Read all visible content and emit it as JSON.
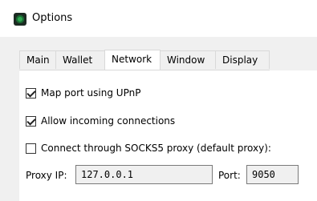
{
  "window": {
    "title": "Options"
  },
  "tabs": [
    {
      "label": "Main"
    },
    {
      "label": "Wallet"
    },
    {
      "label": "Network",
      "active": true
    },
    {
      "label": "Window"
    },
    {
      "label": "Display"
    }
  ],
  "network": {
    "upnp": {
      "label": "Map port using UPnP",
      "checked": true
    },
    "incoming": {
      "label": "Allow incoming connections",
      "checked": true
    },
    "socks5": {
      "label": "Connect through SOCKS5 proxy (default proxy):",
      "checked": false
    },
    "proxy_ip": {
      "label": "Proxy IP:",
      "value": "127.0.0.1"
    },
    "port": {
      "label": "Port:",
      "value": "9050"
    }
  }
}
